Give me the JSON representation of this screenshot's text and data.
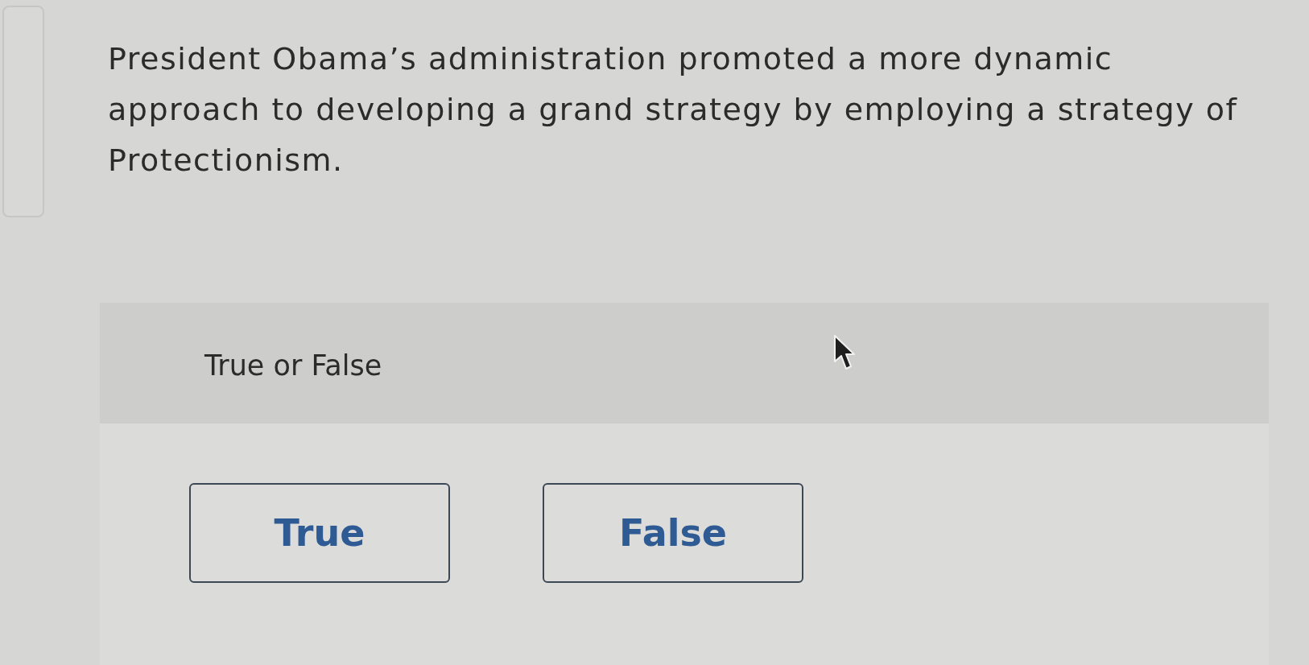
{
  "question": {
    "lines": [
      "President Obama’s administration promoted a more dynamic",
      "approach to developing a grand strategy by employing a strategy of",
      "Protectionism."
    ]
  },
  "answer_area": {
    "prompt": "True or False",
    "choices": [
      {
        "label": "True",
        "selected": false
      },
      {
        "label": "False",
        "selected": false
      }
    ]
  }
}
